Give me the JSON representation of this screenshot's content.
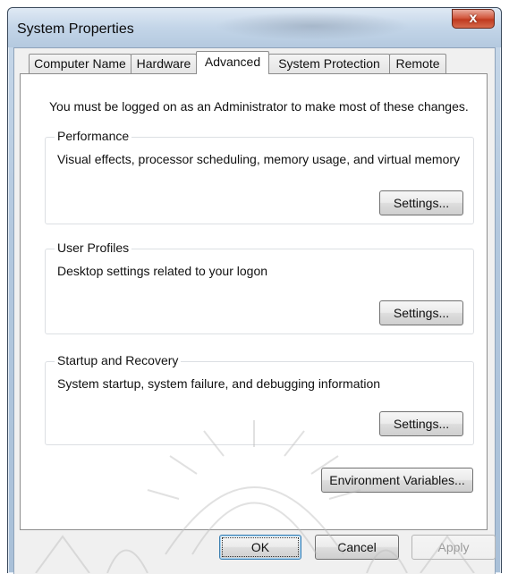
{
  "window": {
    "title": "System Properties",
    "close_glyph": "x"
  },
  "tabs": [
    {
      "label": "Computer Name",
      "active": false
    },
    {
      "label": "Hardware",
      "active": false
    },
    {
      "label": "Advanced",
      "active": true
    },
    {
      "label": "System Protection",
      "active": false
    },
    {
      "label": "Remote",
      "active": false
    }
  ],
  "advanced": {
    "notice": "You must be logged on as an Administrator to make most of these changes.",
    "groups": [
      {
        "label": "Performance",
        "description": "Visual effects, processor scheduling, memory usage, and virtual memory",
        "button": "Settings..."
      },
      {
        "label": "User Profiles",
        "description": "Desktop settings related to your logon",
        "button": "Settings..."
      },
      {
        "label": "Startup and Recovery",
        "description": "System startup, system failure, and debugging information",
        "button": "Settings..."
      }
    ],
    "env_button": "Environment Variables..."
  },
  "footer": {
    "ok": "OK",
    "cancel": "Cancel",
    "apply": "Apply"
  },
  "colors": {
    "close_button": "#c9432a",
    "default_button_border": "#3c7fb1",
    "watermark": "#b7b7b7"
  },
  "icons": {
    "close": "close-icon"
  }
}
